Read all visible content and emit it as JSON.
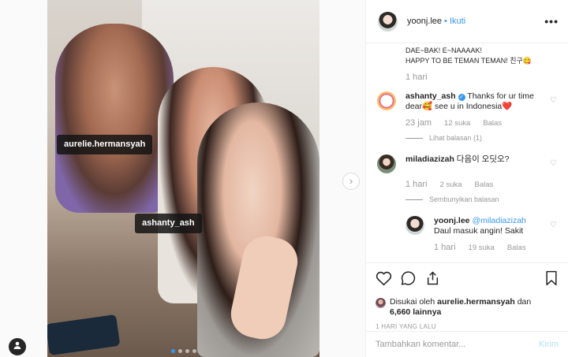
{
  "post": {
    "tags": [
      "aurelie.hermansyah",
      "ashanty_ash"
    ],
    "carousel_total": 4,
    "carousel_current": 1
  },
  "header": {
    "username": "yoonj.lee",
    "follow_label": "• Ikuti",
    "more_icon": "more-icon"
  },
  "caption": {
    "line1": "DAE~BAK! E~NAAAAK!",
    "line2": "HAPPY TO BE TEMAN TEMAN! 친구😋",
    "time": "1 hari"
  },
  "comments": [
    {
      "user": "ashanty_ash",
      "verified": true,
      "text": "Thanks for ur time dear🥰 see u in Indonesia❤️",
      "time": "23 jam",
      "likes": "12 suka",
      "reply_label": "Balas",
      "replies_link": "Lihat balasan (1)"
    },
    {
      "user": "miladiazizah",
      "text": "다음이 오딧오?",
      "time": "1 hari",
      "likes": "2 suka",
      "reply_label": "Balas",
      "replies_link": "Sembunyikan balasan"
    }
  ],
  "reply": {
    "user": "yoonj.lee",
    "mention": "@miladiazizah",
    "text": "Daul masuk angin! Sakit",
    "time": "1 hari",
    "likes": "19 suka",
    "reply_label": "Balas"
  },
  "likes": {
    "prefix": "Disukai oleh",
    "user": "aurelie.hermansyah",
    "conj": "dan",
    "count": "6,660 lainnya"
  },
  "posted_ago": "1 HARI YANG LALU",
  "composer": {
    "placeholder": "Tambahkan komentar...",
    "post_label": "Kirim"
  },
  "colors": {
    "link_blue": "#3897f0",
    "muted": "#999999",
    "text": "#262626"
  }
}
